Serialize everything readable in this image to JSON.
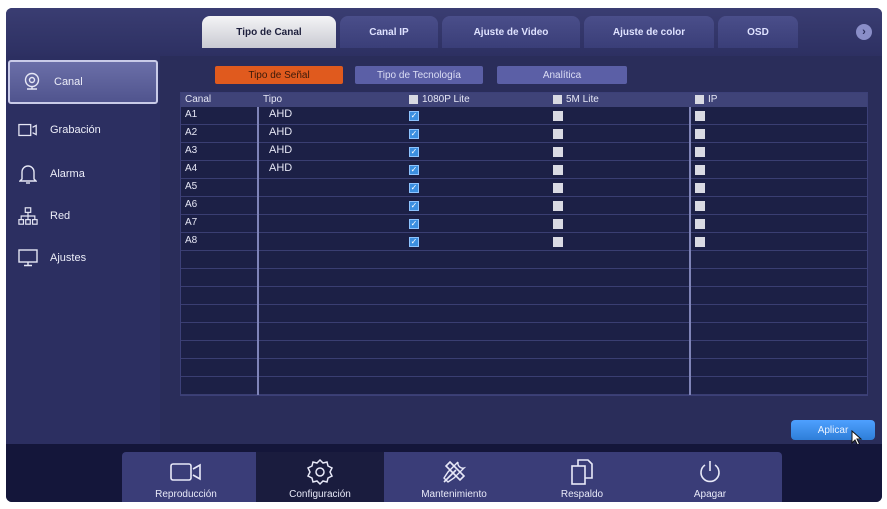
{
  "top_tabs": [
    "Tipo de Canal",
    "Canal IP",
    "Ajuste de Video",
    "Ajuste de color",
    "OSD"
  ],
  "next_arrow": "›",
  "sidebar": {
    "items": [
      {
        "label": "Canal",
        "icon": "camera-icon"
      },
      {
        "label": "Grabación",
        "icon": "video-camera-icon"
      },
      {
        "label": "Alarma",
        "icon": "bell-icon"
      },
      {
        "label": "Red",
        "icon": "network-icon"
      },
      {
        "label": "Ajustes",
        "icon": "monitor-icon"
      }
    ]
  },
  "sub_tabs": [
    "Tipo de Señal",
    "Tipo de Tecnología",
    "Analítica"
  ],
  "table": {
    "headers": [
      "Canal",
      "Tipo",
      "1080P Lite",
      "5M Lite",
      "IP"
    ],
    "rows": [
      {
        "canal": "A1",
        "tipo": "AHD",
        "p1080_lite": true,
        "m5_lite": false,
        "ip": false
      },
      {
        "canal": "A2",
        "tipo": "AHD",
        "p1080_lite": true,
        "m5_lite": false,
        "ip": false
      },
      {
        "canal": "A3",
        "tipo": "AHD",
        "p1080_lite": true,
        "m5_lite": false,
        "ip": false
      },
      {
        "canal": "A4",
        "tipo": "AHD",
        "p1080_lite": true,
        "m5_lite": false,
        "ip": false
      },
      {
        "canal": "A5",
        "tipo": "",
        "p1080_lite": true,
        "m5_lite": false,
        "ip": false
      },
      {
        "canal": "A6",
        "tipo": "",
        "p1080_lite": true,
        "m5_lite": false,
        "ip": false
      },
      {
        "canal": "A7",
        "tipo": "",
        "p1080_lite": true,
        "m5_lite": false,
        "ip": false
      },
      {
        "canal": "A8",
        "tipo": "",
        "p1080_lite": true,
        "m5_lite": false,
        "ip": false
      }
    ],
    "empty_rows": 8
  },
  "apply_label": "Aplicar",
  "bottom_nav": [
    {
      "label": "Reproducción",
      "icon": "video-camera-icon"
    },
    {
      "label": "Configuración",
      "icon": "gear-icon"
    },
    {
      "label": "Mantenimiento",
      "icon": "tools-icon"
    },
    {
      "label": "Respaldo",
      "icon": "copy-icon"
    },
    {
      "label": "Apagar",
      "icon": "power-icon"
    }
  ],
  "colors": {
    "accent": "#e05a1e",
    "apply": "#3a8ef0",
    "background": "#2a2d5a"
  }
}
